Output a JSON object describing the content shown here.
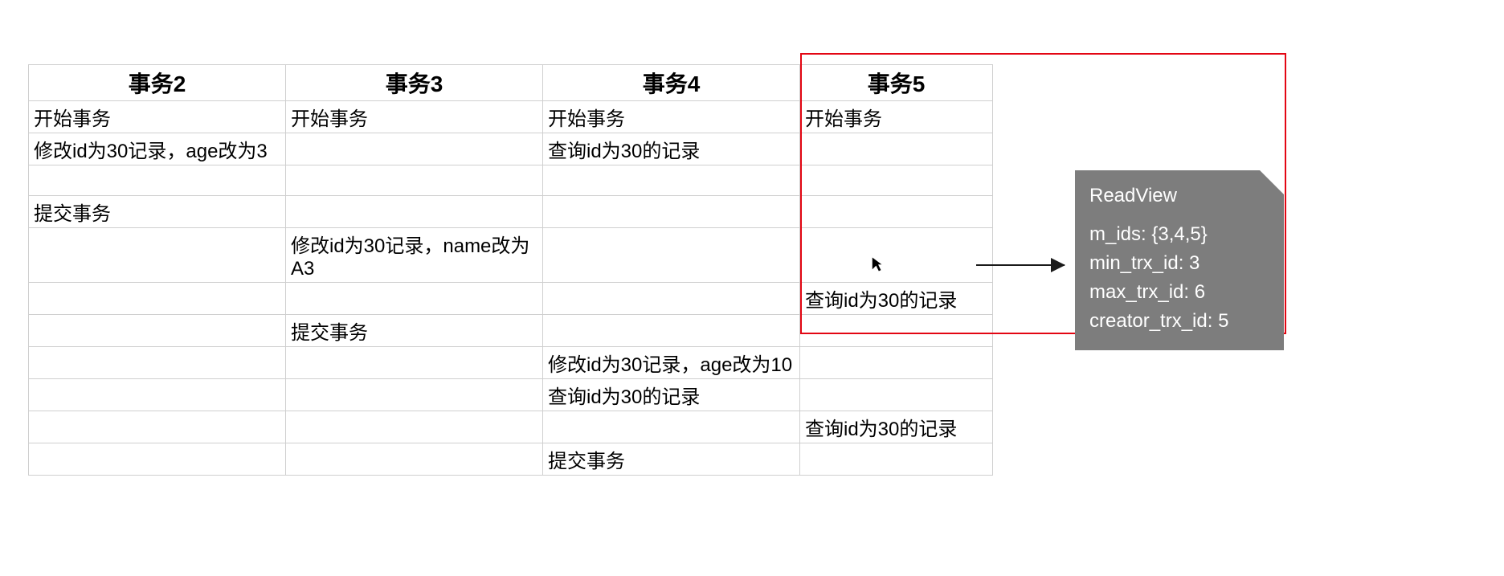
{
  "table": {
    "headers": [
      "事务2",
      "事务3",
      "事务4",
      "事务5"
    ],
    "rows": [
      [
        "开始事务",
        "开始事务",
        "开始事务",
        "开始事务"
      ],
      [
        "修改id为30记录，age改为3",
        "",
        "查询id为30的记录",
        ""
      ],
      [
        "",
        "",
        "",
        ""
      ],
      [
        "提交事务",
        "",
        "",
        ""
      ],
      [
        "",
        "修改id为30记录，name改为A3",
        "",
        ""
      ],
      [
        "",
        "",
        "",
        "查询id为30的记录"
      ],
      [
        "",
        "提交事务",
        "",
        ""
      ],
      [
        "",
        "",
        "修改id为30记录，age改为10",
        ""
      ],
      [
        "",
        "",
        "查询id为30的记录",
        ""
      ],
      [
        "",
        "",
        "",
        "查询id为30的记录"
      ],
      [
        "",
        "",
        "提交事务",
        ""
      ]
    ]
  },
  "note": {
    "title": "ReadView",
    "m_ids": "m_ids: {3,4,5}",
    "min_trx_id": "min_trx_id: 3",
    "max_trx_id": "max_trx_id: 6",
    "creator_trx_id": "creator_trx_id: 5"
  }
}
